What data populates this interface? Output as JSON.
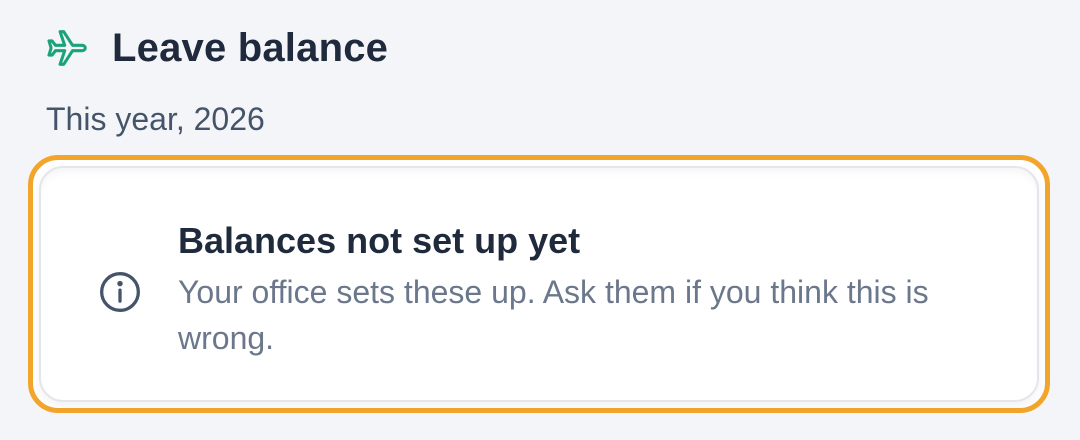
{
  "header": {
    "icon": "airplane-icon",
    "title": "Leave balance",
    "accent_color": "#1aa37a"
  },
  "period": {
    "label": "This year, 2026"
  },
  "notice": {
    "icon": "info-icon",
    "title": "Balances not set up yet",
    "message": "Your office sets these up. Ask them if you think this is wrong.",
    "highlight_color": "#f3a52b"
  }
}
